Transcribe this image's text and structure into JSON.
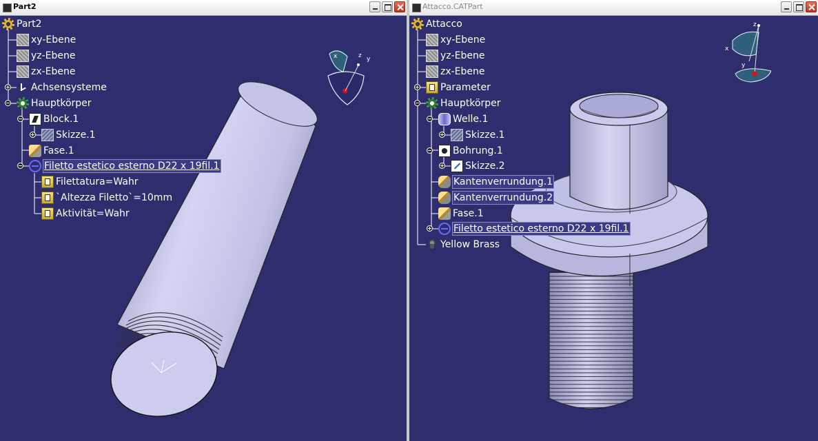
{
  "windows": {
    "left": {
      "title": "Part2",
      "tree": {
        "root": "Part2",
        "items": [
          {
            "label": "xy-Ebene"
          },
          {
            "label": "yz-Ebene"
          },
          {
            "label": "zx-Ebene"
          },
          {
            "label": "Achsensysteme"
          },
          {
            "label": "Hauptkörper"
          },
          {
            "label": "Block.1"
          },
          {
            "label": "Skizze.1"
          },
          {
            "label": "Fase.1"
          },
          {
            "label": "Filetto estetico esterno D22 x 19fil.1"
          },
          {
            "label": "Filettatura=Wahr"
          },
          {
            "label": "`Altezza Filetto`=10mm"
          },
          {
            "label": "Aktivität=Wahr"
          }
        ]
      },
      "compass_labels": {
        "x": "x",
        "y": "y",
        "z": "z"
      }
    },
    "right": {
      "title": "Attacco.CATPart",
      "tree": {
        "root": "Attacco",
        "items": [
          {
            "label": "xy-Ebene"
          },
          {
            "label": "yz-Ebene"
          },
          {
            "label": "zx-Ebene"
          },
          {
            "label": "Parameter"
          },
          {
            "label": "Hauptkörper"
          },
          {
            "label": "Welle.1"
          },
          {
            "label": "Skizze.1"
          },
          {
            "label": "Bohrung.1"
          },
          {
            "label": "Skizze.2"
          },
          {
            "label": "Kantenverrundung.1"
          },
          {
            "label": "Kantenverrundung.2"
          },
          {
            "label": "Fase.1"
          },
          {
            "label": "Filetto estetico esterno D22 x 19fil.1"
          },
          {
            "label": "Yellow Brass"
          }
        ]
      },
      "compass_labels": {
        "x": "x",
        "y": "y",
        "z": "z"
      }
    }
  },
  "colors": {
    "viewport_background": "#2e2e6e",
    "part_surface": "#c8c8ec",
    "selection_highlight": "#3a3a86"
  }
}
